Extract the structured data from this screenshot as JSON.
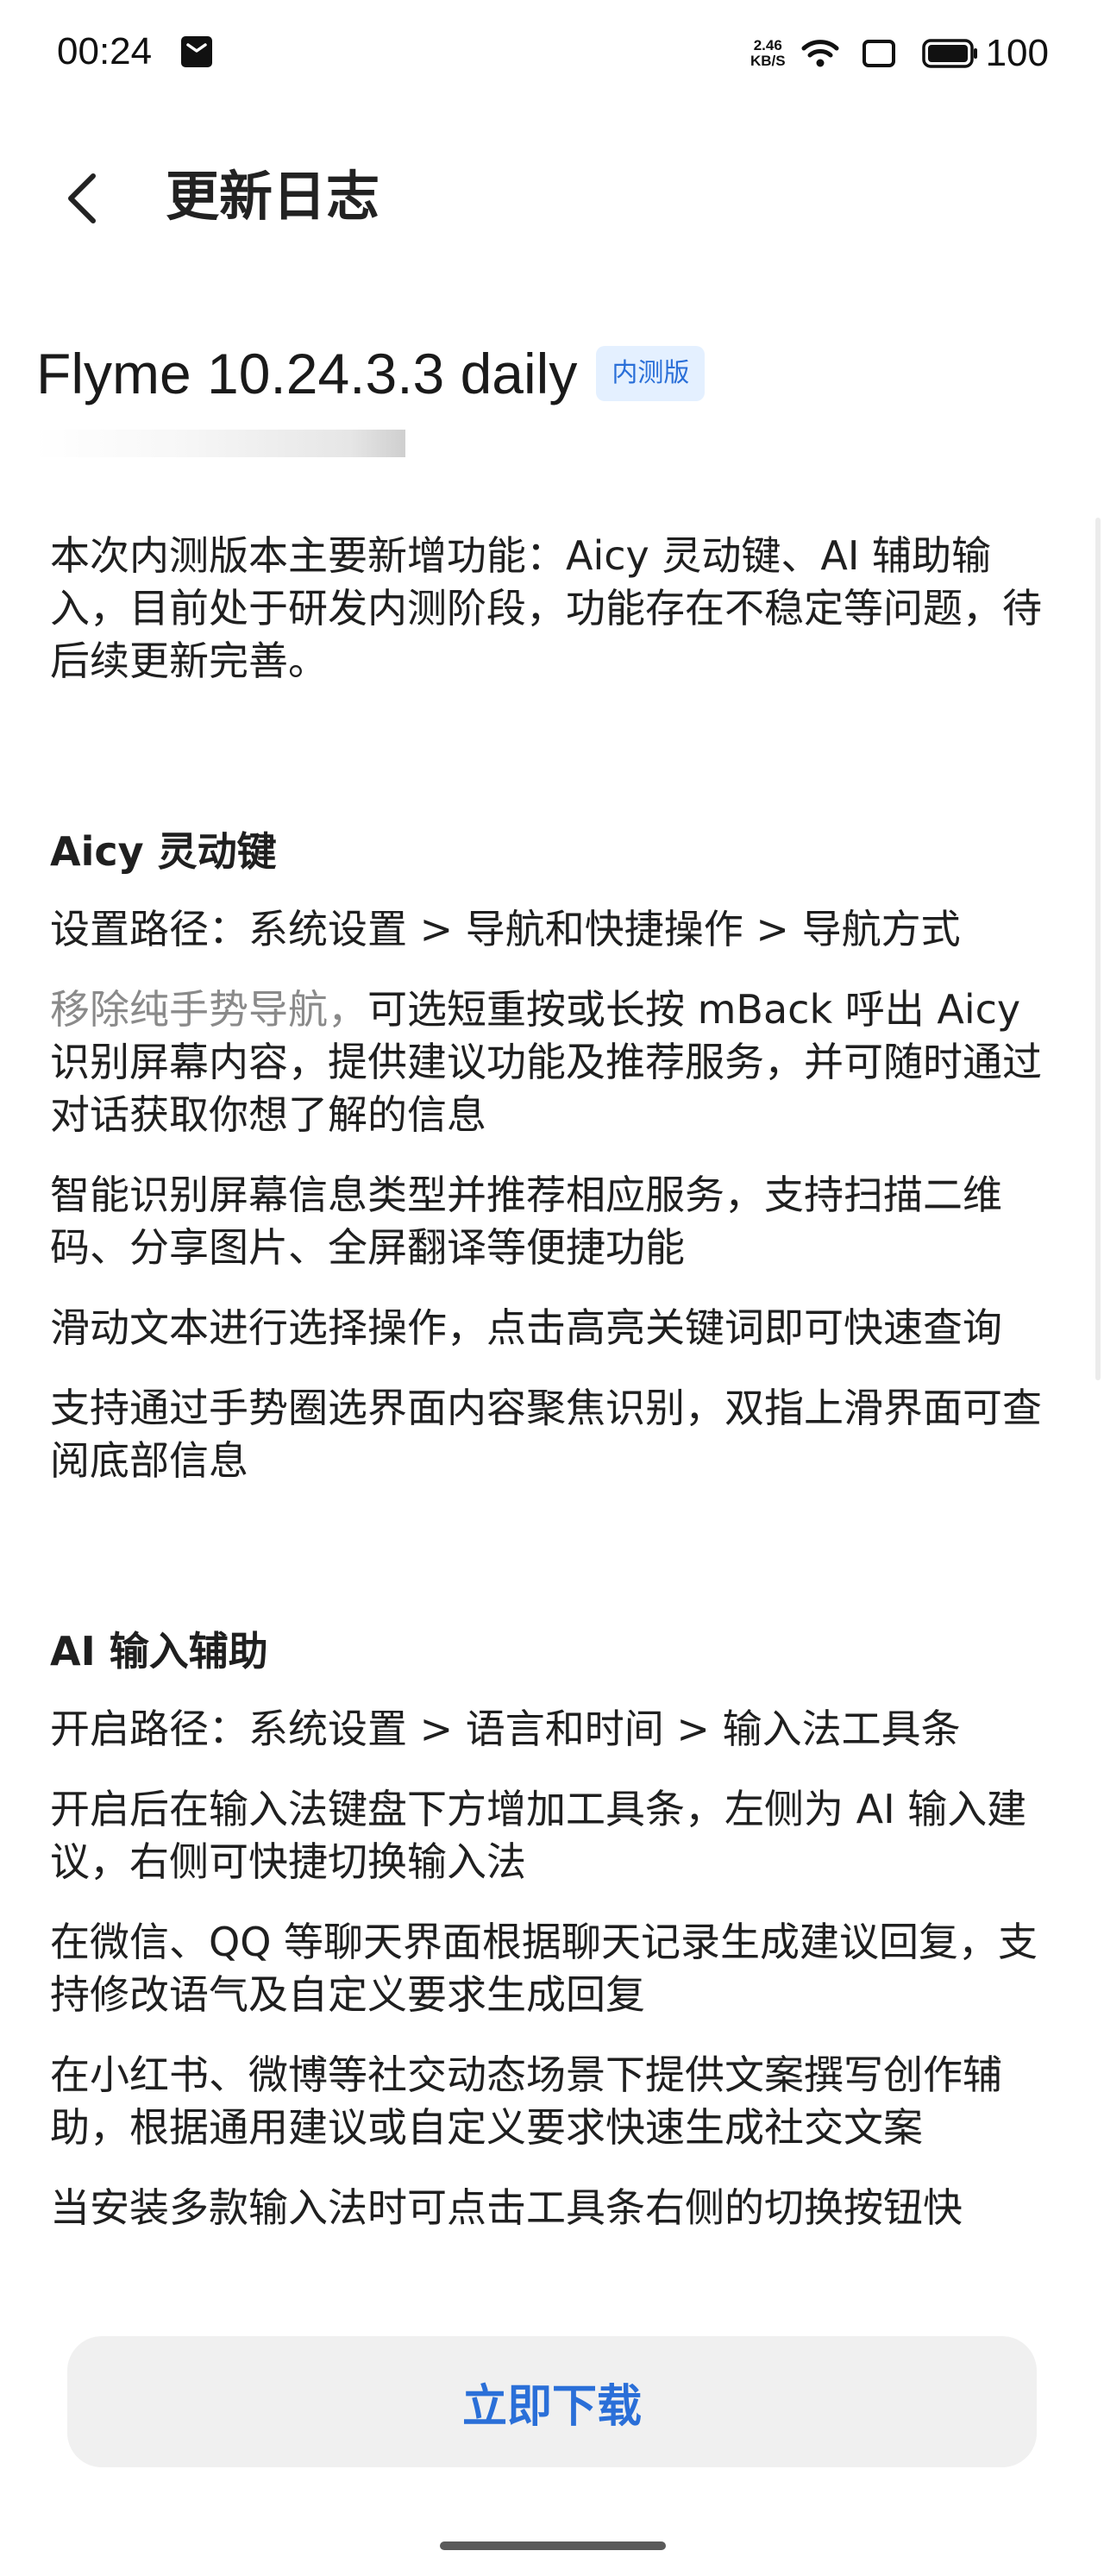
{
  "status_bar": {
    "time": "00:24",
    "net_speed_value": "2.46",
    "net_speed_unit": "KB/S",
    "battery": "100"
  },
  "header": {
    "title": "更新日志"
  },
  "release": {
    "version": "Flyme 10.24.3.3 daily",
    "badge": "内测版"
  },
  "intro": "本次内测版本主要新增功能：Aicy 灵动键、AI 辅助输入，目前处于研发内测阶段，功能存在不稳定等问题，待后续更新完善。",
  "sections": [
    {
      "title": "Aicy 灵动键",
      "path": "设置路径：系统设置 > 导航和快捷操作 > 导航方式",
      "first_item_muted": "移除纯手势导航，",
      "first_item_rest": "可选短重按或长按 mBack 呼出 Aicy 识别屏幕内容，提供建议功能及推荐服务，并可随时通过对话获取你想了解的信息",
      "items": [
        "智能识别屏幕信息类型并推荐相应服务，支持扫描二维码、分享图片、全屏翻译等便捷功能",
        "滑动文本进行选择操作，点击高亮关键词即可快速查询",
        "支持通过手势圈选界面内容聚焦识别，双指上滑界面可查阅底部信息"
      ]
    },
    {
      "title": "AI 输入辅助",
      "path": "开启路径：系统设置 > 语言和时间 > 输入法工具条",
      "items": [
        "开启后在输入法键盘下方增加工具条，左侧为 AI 输入建议，右侧可快捷切换输入法",
        "在微信、QQ 等聊天界面根据聊天记录生成建议回复，支持修改语气及自定义要求生成回复",
        "在小红书、微博等社交动态场景下提供文案撰写创作辅助，根据通用建议或自定义要求快速生成社交文案",
        "当安装多款输入法时可点击工具条右侧的切换按钮快"
      ]
    }
  ],
  "download_button": "立即下载",
  "colors": {
    "accent": "#2a6fd8",
    "badge_bg": "#e4f0ff",
    "button_bg": "#f0f0f0",
    "muted_text": "#8a8a8a"
  }
}
